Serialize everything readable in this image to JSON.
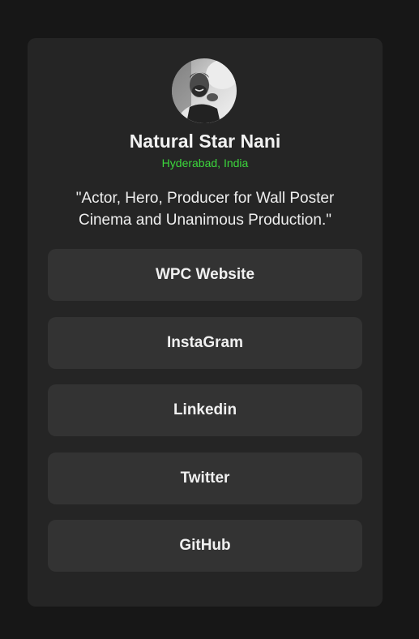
{
  "profile": {
    "name": "Natural Star Nani",
    "location": "Hyderabad, India",
    "bio": "\"Actor, Hero, Producer for Wall Poster Cinema and Unanimous Production.\"",
    "avatar": "profile-photo"
  },
  "links": [
    {
      "label": "WPC Website"
    },
    {
      "label": "InstaGram"
    },
    {
      "label": "Linkedin"
    },
    {
      "label": "Twitter"
    },
    {
      "label": "GitHub"
    }
  ],
  "colors": {
    "page_background": "#171717",
    "card_background": "#252525",
    "button_background": "#333333",
    "location_accent": "#3cd63c",
    "text": "#f2f2f2"
  }
}
